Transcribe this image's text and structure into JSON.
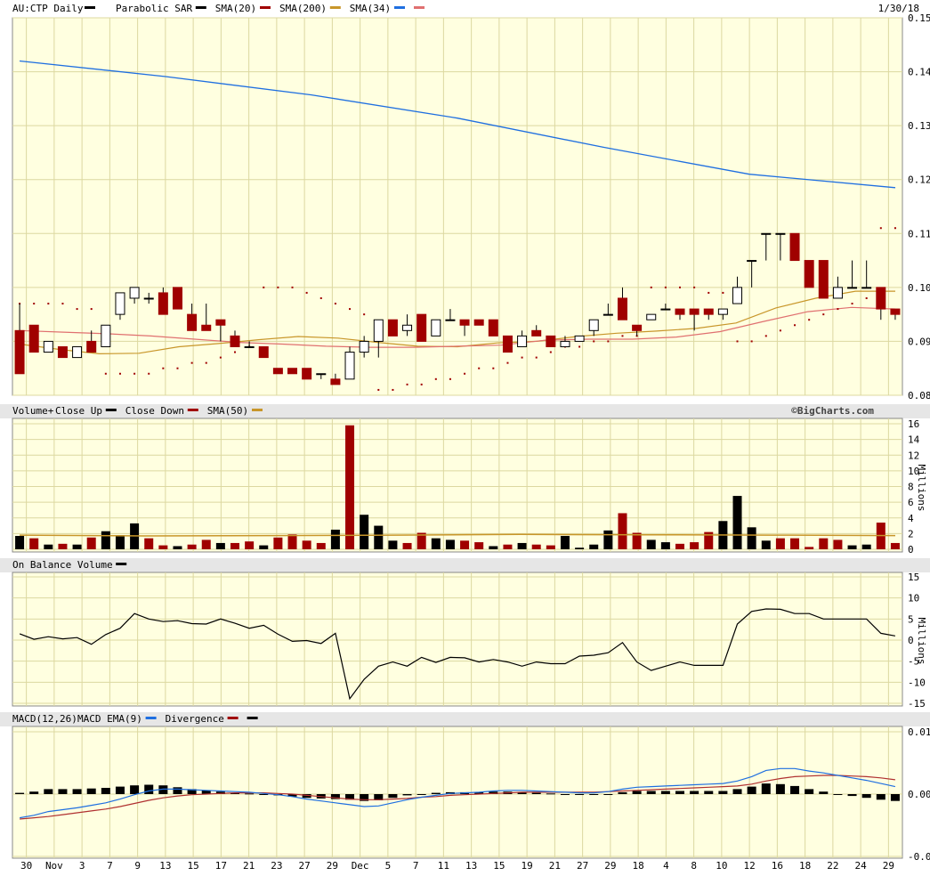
{
  "header": {
    "symbol_title": "AU:CTP Daily",
    "date": "1/30/18"
  },
  "legend": {
    "main": [
      {
        "label": "Parabolic SAR",
        "color": "#000000"
      },
      {
        "label": "SMA(20)",
        "color": "#a00000"
      },
      {
        "label": "SMA(200)",
        "color": "#c8962a"
      },
      {
        "label": "SMA(34)",
        "color": "#1f6fe0"
      },
      {
        "label": "",
        "color": "#e07070"
      }
    ],
    "volume_title": "Volume+",
    "volume": [
      {
        "label": "Close Up",
        "color": "#000000"
      },
      {
        "label": "Close Down",
        "color": "#a00000"
      },
      {
        "label": "SMA(50)",
        "color": "#c8962a"
      }
    ],
    "obv": [
      {
        "label": "On Balance Volume",
        "color": "#000000"
      }
    ],
    "macd_title": "MACD(12,26)",
    "macd": [
      {
        "label": "MACD EMA(9)",
        "color": "#1f6fe0"
      },
      {
        "label": "Divergence",
        "color": "#a00000"
      },
      {
        "label": "",
        "color": "#000000"
      }
    ],
    "credit": "©BigCharts.com"
  },
  "colors": {
    "panel_bg": "#ffffe0",
    "grid": "#dcd8a0",
    "up": "#000000",
    "down": "#a00000",
    "sma200": "#c8962a",
    "sma34": "#1f6fe0",
    "sma20": "#e07070",
    "obv": "#000000",
    "macd": "#1f6fe0",
    "signal": "#b03030"
  },
  "x_axis_labels": [
    "30",
    "Nov",
    "3",
    "7",
    "9",
    "13",
    "15",
    "17",
    "21",
    "23",
    "27",
    "29",
    "Dec",
    "5",
    "7",
    "11",
    "13",
    "15",
    "19",
    "21",
    "27",
    "29",
    "18",
    "4",
    "8",
    "10",
    "12",
    "16",
    "18",
    "22",
    "24",
    "29"
  ],
  "chart_data": [
    {
      "type": "candlestick",
      "title": "AU:CTP Daily",
      "y_ticks": [
        "0.08",
        "0.09",
        "0.10",
        "0.11",
        "0.12",
        "0.13",
        "0.14",
        "0.15"
      ],
      "ylim": [
        0.08,
        0.15
      ],
      "ohlc": [
        [
          0.092,
          0.097,
          0.084,
          0.084
        ],
        [
          0.093,
          0.093,
          0.088,
          0.088
        ],
        [
          0.088,
          0.09,
          0.088,
          0.09
        ],
        [
          0.089,
          0.089,
          0.087,
          0.087
        ],
        [
          0.087,
          0.089,
          0.087,
          0.089
        ],
        [
          0.09,
          0.092,
          0.088,
          0.088
        ],
        [
          0.089,
          0.093,
          0.089,
          0.093
        ],
        [
          0.095,
          0.099,
          0.094,
          0.099
        ],
        [
          0.098,
          0.1,
          0.097,
          0.1
        ],
        [
          0.098,
          0.099,
          0.097,
          0.098
        ],
        [
          0.099,
          0.1,
          0.095,
          0.095
        ],
        [
          0.1,
          0.1,
          0.096,
          0.096
        ],
        [
          0.095,
          0.097,
          0.092,
          0.092
        ],
        [
          0.093,
          0.097,
          0.092,
          0.092
        ],
        [
          0.094,
          0.094,
          0.09,
          0.093
        ],
        [
          0.091,
          0.092,
          0.089,
          0.089
        ],
        [
          0.089,
          0.09,
          0.089,
          0.089
        ],
        [
          0.089,
          0.089,
          0.087,
          0.087
        ],
        [
          0.085,
          0.085,
          0.084,
          0.084
        ],
        [
          0.085,
          0.085,
          0.084,
          0.084
        ],
        [
          0.085,
          0.085,
          0.083,
          0.083
        ],
        [
          0.084,
          0.084,
          0.083,
          0.084
        ],
        [
          0.083,
          0.084,
          0.082,
          0.082
        ],
        [
          0.083,
          0.089,
          0.083,
          0.088
        ],
        [
          0.088,
          0.091,
          0.087,
          0.09
        ],
        [
          0.09,
          0.094,
          0.087,
          0.094
        ],
        [
          0.094,
          0.094,
          0.091,
          0.091
        ],
        [
          0.092,
          0.095,
          0.091,
          0.093
        ],
        [
          0.095,
          0.095,
          0.09,
          0.09
        ],
        [
          0.091,
          0.094,
          0.091,
          0.094
        ],
        [
          0.094,
          0.096,
          0.094,
          0.094
        ],
        [
          0.094,
          0.094,
          0.091,
          0.093
        ],
        [
          0.094,
          0.094,
          0.093,
          0.093
        ],
        [
          0.094,
          0.094,
          0.091,
          0.091
        ],
        [
          0.091,
          0.091,
          0.088,
          0.088
        ],
        [
          0.089,
          0.092,
          0.089,
          0.091
        ],
        [
          0.092,
          0.093,
          0.091,
          0.091
        ],
        [
          0.091,
          0.091,
          0.089,
          0.089
        ],
        [
          0.089,
          0.091,
          0.089,
          0.09
        ],
        [
          0.09,
          0.091,
          0.09,
          0.091
        ],
        [
          0.092,
          0.094,
          0.091,
          0.094
        ],
        [
          0.095,
          0.097,
          0.095,
          0.095
        ],
        [
          0.098,
          0.1,
          0.094,
          0.094
        ],
        [
          0.093,
          0.093,
          0.091,
          0.092
        ],
        [
          0.094,
          0.095,
          0.094,
          0.095
        ],
        [
          0.096,
          0.097,
          0.096,
          0.096
        ],
        [
          0.096,
          0.096,
          0.094,
          0.095
        ],
        [
          0.096,
          0.096,
          0.092,
          0.095
        ],
        [
          0.096,
          0.096,
          0.094,
          0.095
        ],
        [
          0.095,
          0.096,
          0.094,
          0.096
        ],
        [
          0.097,
          0.102,
          0.097,
          0.1
        ],
        [
          0.105,
          0.105,
          0.1,
          0.105
        ],
        [
          0.11,
          0.11,
          0.105,
          0.11
        ],
        [
          0.11,
          0.11,
          0.105,
          0.11
        ],
        [
          0.11,
          0.11,
          0.105,
          0.105
        ],
        [
          0.105,
          0.105,
          0.1,
          0.1
        ],
        [
          0.105,
          0.105,
          0.1,
          0.098
        ],
        [
          0.098,
          0.102,
          0.098,
          0.1
        ],
        [
          0.1,
          0.105,
          0.1,
          0.1
        ],
        [
          0.1,
          0.105,
          0.1,
          0.1
        ],
        [
          0.1,
          0.1,
          0.094,
          0.096
        ],
        [
          0.096,
          0.096,
          0.094,
          0.095
        ]
      ],
      "sar": [
        0.097,
        0.097,
        0.097,
        0.097,
        0.096,
        0.096,
        0.084,
        0.084,
        0.084,
        0.084,
        0.085,
        0.085,
        0.086,
        0.086,
        0.087,
        0.088,
        0.089,
        0.1,
        0.1,
        0.1,
        0.099,
        0.098,
        0.097,
        0.096,
        0.095,
        0.081,
        0.081,
        0.082,
        0.082,
        0.083,
        0.083,
        0.084,
        0.085,
        0.085,
        0.086,
        0.087,
        0.087,
        0.088,
        0.089,
        0.089,
        0.09,
        0.09,
        0.091,
        0.091,
        0.1,
        0.1,
        0.1,
        0.1,
        0.099,
        0.099,
        0.09,
        0.09,
        0.091,
        0.092,
        0.093,
        0.094,
        0.095,
        0.096,
        0.097,
        0.098,
        0.111,
        0.111
      ],
      "sma200": [
        0.142,
        0.1391,
        0.1357,
        0.1314,
        0.126,
        0.121,
        0.1185
      ],
      "sma34": [
        0.0895,
        0.0885,
        0.0877,
        0.0878,
        0.089,
        0.0896,
        0.0903,
        0.0909,
        0.0906,
        0.0898,
        0.0891,
        0.089,
        0.0897,
        0.09,
        0.0909,
        0.0915,
        0.0919,
        0.0924,
        0.0934,
        0.0962,
        0.098,
        0.0993,
        0.0993
      ],
      "sma20": [
        0.092,
        0.0917,
        0.0914,
        0.091,
        0.0904,
        0.0898,
        0.0895,
        0.0891,
        0.0889,
        0.0889,
        0.0891,
        0.0893,
        0.0902,
        0.0904,
        0.0904,
        0.0908,
        0.0918,
        0.0937,
        0.0955,
        0.0963,
        0.096
      ]
    },
    {
      "type": "bar",
      "title": "Volume+",
      "ylabel": "Millions",
      "y_ticks": [
        "0",
        "2",
        "4",
        "6",
        "8",
        "10",
        "12",
        "14",
        "16"
      ],
      "ylim": [
        0,
        16
      ],
      "values": [
        1.7,
        1.4,
        0.6,
        0.7,
        0.6,
        1.5,
        2.3,
        1.8,
        3.3,
        1.4,
        0.5,
        0.4,
        0.6,
        1.2,
        0.8,
        0.8,
        1.0,
        0.5,
        1.5,
        1.9,
        1.1,
        0.8,
        2.5,
        15.8,
        4.4,
        3.0,
        1.1,
        0.8,
        2.1,
        1.4,
        1.2,
        1.1,
        0.9,
        0.4,
        0.6,
        0.8,
        0.6,
        0.5,
        1.7,
        0.2,
        0.6,
        2.4,
        4.6,
        2.1,
        1.2,
        0.9,
        0.7,
        0.9,
        2.2,
        3.6,
        6.8,
        2.8,
        1.1,
        1.4,
        1.4,
        0.3,
        1.4,
        1.2,
        0.5,
        0.6,
        3.4,
        0.8
      ],
      "close_up": [
        1,
        0,
        1,
        0,
        1,
        0,
        1,
        1,
        1,
        0,
        0,
        1,
        0,
        0,
        1,
        0,
        0,
        1,
        0,
        0,
        0,
        0,
        1,
        0,
        1,
        1,
        1,
        0,
        0,
        1,
        1,
        0,
        0,
        1,
        0,
        1,
        0,
        0,
        1,
        1,
        1,
        1,
        0,
        0,
        1,
        1,
        0,
        0,
        0,
        1,
        1,
        1,
        1,
        0,
        0,
        0,
        0,
        0,
        1,
        1,
        0,
        0
      ],
      "sma50": [
        1.8,
        1.7,
        1.75,
        1.8,
        1.9,
        1.85,
        1.8,
        1.75
      ]
    },
    {
      "type": "line",
      "title": "On Balance Volume",
      "ylabel": "Millions",
      "y_ticks": [
        "15",
        "10",
        "5",
        "0",
        "-5",
        "-10",
        "-15"
      ],
      "ylim": [
        -15,
        15
      ],
      "values": [
        1.5,
        0.2,
        0.8,
        0.3,
        0.6,
        -1.0,
        1.3,
        2.8,
        6.3,
        5.0,
        4.4,
        4.6,
        3.9,
        3.8,
        5.0,
        4.0,
        2.8,
        3.5,
        1.4,
        -0.3,
        -0.1,
        -0.8,
        1.6,
        -13.9,
        -9.3,
        -6.2,
        -5.2,
        -6.2,
        -4.1,
        -5.3,
        -4.1,
        -4.2,
        -5.2,
        -4.6,
        -5.2,
        -6.2,
        -5.2,
        -5.6,
        -5.6,
        -3.8,
        -3.6,
        -3.0,
        -0.6,
        -5.2,
        -7.2,
        -6.2,
        -5.2,
        -6.0,
        -6.0,
        -6.0,
        3.8,
        6.8,
        7.4,
        7.3,
        6.3,
        6.3,
        5.0,
        5.0,
        5.0,
        5.0,
        1.6,
        1.0
      ]
    },
    {
      "type": "line",
      "title": "MACD(12,26)",
      "y_ticks": [
        "0.01",
        "0.00",
        "-0.01"
      ],
      "ylim": [
        -0.01,
        0.01
      ],
      "macd": [
        -0.0038,
        -0.0034,
        -0.0028,
        -0.0025,
        -0.0022,
        -0.0018,
        -0.0014,
        -0.0008,
        -0.0001,
        0.0005,
        0.0008,
        0.0008,
        0.0007,
        0.0006,
        0.0005,
        0.0004,
        0.0003,
        0.0001,
        -0.0001,
        -0.0004,
        -0.0008,
        -0.0011,
        -0.0014,
        -0.0017,
        -0.002,
        -0.0019,
        -0.0014,
        -0.0009,
        -0.0005,
        -0.0002,
        0.0001,
        0.0002,
        0.0003,
        0.0005,
        0.0006,
        0.0006,
        0.0005,
        0.0004,
        0.0003,
        0.0002,
        0.0002,
        0.0004,
        0.0008,
        0.0011,
        0.0012,
        0.0013,
        0.0014,
        0.0015,
        0.0016,
        0.0017,
        0.0021,
        0.0028,
        0.0038,
        0.0041,
        0.0041,
        0.0037,
        0.0034,
        0.003,
        0.0026,
        0.0022,
        0.0017,
        0.0012
      ],
      "signal": [
        -0.004,
        -0.0038,
        -0.0036,
        -0.0033,
        -0.003,
        -0.0027,
        -0.0024,
        -0.002,
        -0.0015,
        -0.001,
        -0.0006,
        -0.0003,
        -0.0001,
        0.0,
        0.0001,
        0.0002,
        0.0002,
        0.0002,
        0.0001,
        0.0,
        -0.0002,
        -0.0004,
        -0.0006,
        -0.0008,
        -0.0009,
        -0.0009,
        -0.0008,
        -0.0007,
        -0.0005,
        -0.0004,
        -0.0002,
        -0.0001,
        0.0,
        0.0001,
        0.0002,
        0.0003,
        0.0003,
        0.0003,
        0.0003,
        0.0003,
        0.0003,
        0.0004,
        0.0005,
        0.0006,
        0.0007,
        0.0008,
        0.0009,
        0.001,
        0.0011,
        0.0012,
        0.0013,
        0.0016,
        0.0021,
        0.0025,
        0.0028,
        0.0029,
        0.003,
        0.003,
        0.0029,
        0.0028,
        0.0026,
        0.0023
      ],
      "divergence": [
        0.0002,
        0.0004,
        0.0008,
        0.0008,
        0.0008,
        0.0009,
        0.001,
        0.0012,
        0.0014,
        0.0015,
        0.0014,
        0.0011,
        0.0008,
        0.0006,
        0.0004,
        0.0002,
        0.0001,
        -0.0001,
        -0.0002,
        -0.0004,
        -0.0006,
        -0.0007,
        -0.0008,
        -0.0009,
        -0.0011,
        -0.001,
        -0.0006,
        -0.0002,
        0.0,
        0.0002,
        0.0003,
        0.0003,
        0.0003,
        0.0004,
        0.0004,
        0.0003,
        0.0002,
        0.0001,
        0.0,
        -0.0001,
        -0.0001,
        0.0,
        0.0003,
        0.0005,
        0.0005,
        0.0005,
        0.0005,
        0.0005,
        0.0005,
        0.0005,
        0.0008,
        0.0012,
        0.0017,
        0.0016,
        0.0013,
        0.0008,
        0.0004,
        0.0,
        -0.0003,
        -0.0006,
        -0.0009,
        -0.0011
      ]
    }
  ]
}
